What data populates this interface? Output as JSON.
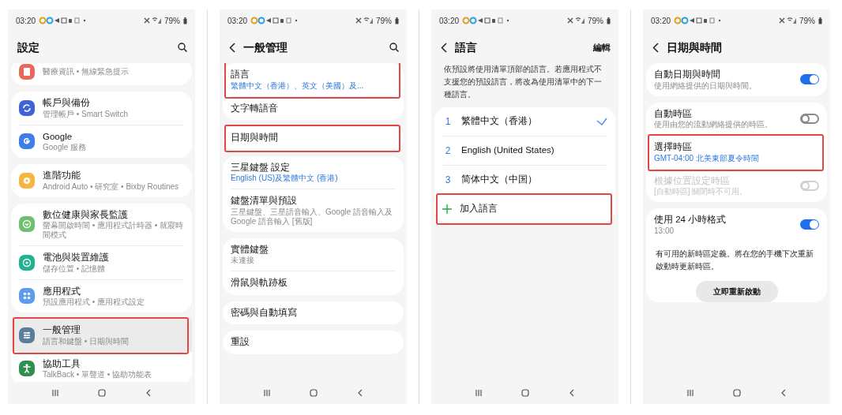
{
  "screens": [
    {
      "time": "03:20",
      "battery": "79%",
      "title": "設定",
      "search": true,
      "scrolled": true,
      "groups": [
        {
          "items": [
            {
              "kind": "nav",
              "color": "#e8695c",
              "subtitle": "醫療資訊 • 無線緊急提示"
            }
          ]
        },
        {
          "items": [
            {
              "kind": "nav",
              "color": "#3f64d8",
              "title": "帳戶與備份",
              "subtitle": "管理帳戶 • Smart Switch"
            },
            {
              "kind": "nav",
              "color": "#3f7ee8",
              "title": "Google",
              "subtitle": "Google 服務"
            }
          ]
        },
        {
          "items": [
            {
              "kind": "nav",
              "color": "#f4b63f",
              "title": "進階功能",
              "subtitle": "Android Auto • 研究室 • Bixby Routines"
            }
          ]
        },
        {
          "items": [
            {
              "kind": "nav",
              "color": "#6cc070",
              "title": "數位健康與家長監護",
              "subtitle": "螢幕開啟時間 • 應用程式計時器 • 就寢時間模式"
            },
            {
              "kind": "nav",
              "color": "#1fb38f",
              "title": "電池與裝置維護",
              "subtitle": "儲存位置 • 記憶體"
            },
            {
              "kind": "nav",
              "color": "#5b9bf0",
              "title": "應用程式",
              "subtitle": "預設應用程式 • 應用程式設定"
            }
          ]
        },
        {
          "items": [
            {
              "kind": "nav",
              "color": "#5a7d9a",
              "title": "一般管理",
              "subtitle": "語言和鍵盤 • 日期與時間",
              "highlighted": true
            },
            {
              "kind": "nav",
              "color": "#2f8f4e",
              "title": "協助工具",
              "subtitle": "TalkBack • 單聲道 • 協助功能表"
            }
          ]
        }
      ]
    },
    {
      "time": "03:20",
      "battery": "79%",
      "title": "一般管理",
      "back": true,
      "search": true,
      "groups": [
        {
          "items": [
            {
              "kind": "nav",
              "title": "語言",
              "subtitle": "繁體中文（香港）、英文（美國）及...",
              "accent": true,
              "highlighted": true
            },
            {
              "kind": "nav",
              "title": "文字轉語音"
            }
          ]
        },
        {
          "items": [
            {
              "kind": "nav",
              "title": "日期與時間",
              "highlighted": true
            }
          ]
        },
        {
          "items": [
            {
              "kind": "nav",
              "title": "三星鍵盤 設定",
              "subtitle": "English (US)及繁體中文 (香港)",
              "accent": true
            },
            {
              "kind": "nav",
              "title": "鍵盤清單與預設",
              "subtitle": "三星鍵盤、三星語音輸入、Google 語音輸入及Google 語音輸入 [舊版]"
            }
          ]
        },
        {
          "items": [
            {
              "kind": "nav",
              "title": "實體鍵盤",
              "subtitle": "未連接"
            },
            {
              "kind": "nav",
              "title": "滑鼠與軌跡板"
            }
          ]
        },
        {
          "items": [
            {
              "kind": "nav",
              "title": "密碼與自動填寫"
            }
          ]
        },
        {
          "items": [
            {
              "kind": "nav",
              "title": "重設"
            }
          ]
        }
      ]
    },
    {
      "time": "03:20",
      "battery": "79%",
      "title": "語言",
      "back": true,
      "action": "編輯",
      "description": "依預設將使用清單頂部的語言。若應用程式不支援您的預設語言，將改為使用清單中的下一種語言。",
      "groups": [
        {
          "items": [
            {
              "kind": "language",
              "number": "1",
              "title": "繁體中文（香港）",
              "selected": true
            },
            {
              "kind": "language",
              "number": "2",
              "title": "English (United States)",
              "selected": false
            },
            {
              "kind": "language",
              "number": "3",
              "title": "简体中文（中国）",
              "selected": false
            },
            {
              "kind": "add",
              "title": "加入語言",
              "highlighted": true
            }
          ]
        }
      ]
    },
    {
      "time": "03:20",
      "battery": "79%",
      "title": "日期與時間",
      "back": true,
      "groups": [
        {
          "items": [
            {
              "kind": "toggle",
              "title": "自動日期與時間",
              "subtitle": "使用網絡提供的日期與時間。",
              "on": true
            }
          ]
        },
        {
          "items": [
            {
              "kind": "toggle",
              "title": "自動時區",
              "subtitle": "使用由您的流動網絡提供的時區。",
              "on": false
            },
            {
              "kind": "nav",
              "title": "選擇時區",
              "subtitle": "GMT-04:00 北美東部夏令時間",
              "accent": true,
              "highlighted": true
            },
            {
              "kind": "toggle",
              "title": "根據位置設定時區",
              "subtitle": "[自動時區] 關閉時不可用。",
              "on": false,
              "disabled": true
            }
          ]
        },
        {
          "items": [
            {
              "kind": "toggle",
              "title": "使用 24 小時格式",
              "subtitle": "13:00",
              "on": true
            },
            {
              "kind": "note",
              "title": "有可用的新時區定義。將在您的手機下次重新啟動時更新時區。"
            },
            {
              "kind": "button",
              "title": "立即重新啟動"
            }
          ]
        }
      ]
    }
  ]
}
